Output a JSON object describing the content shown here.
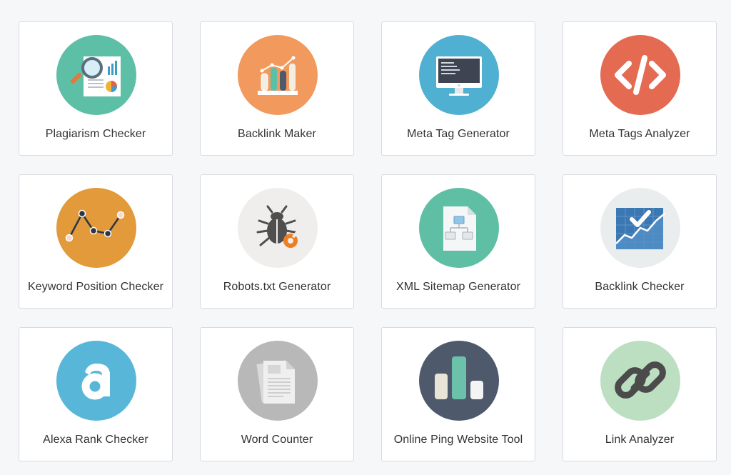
{
  "tools": [
    {
      "label": "Plagiarism Checker",
      "icon": "magnifier-report-icon",
      "color": "#5dbfa6"
    },
    {
      "label": "Backlink Maker",
      "icon": "bar-chart-icon",
      "color": "#f29a5e"
    },
    {
      "label": "Meta Tag Generator",
      "icon": "monitor-code-icon",
      "color": "#4fb0d2"
    },
    {
      "label": "Meta Tags Analyzer",
      "icon": "code-brackets-icon",
      "color": "#e56a52"
    },
    {
      "label": "Keyword Position Checker",
      "icon": "line-graph-icon",
      "color": "#e29a3a"
    },
    {
      "label": "Robots.txt Generator",
      "icon": "bug-icon",
      "color": "#f0eeec"
    },
    {
      "label": "XML Sitemap Generator",
      "icon": "sitemap-document-icon",
      "color": "#5fbfa4"
    },
    {
      "label": "Backlink Checker",
      "icon": "chart-checkmark-icon",
      "color": "#eaedee"
    },
    {
      "label": "Alexa Rank Checker",
      "icon": "alexa-a-icon",
      "color": "#58b7d9"
    },
    {
      "label": "Word Counter",
      "icon": "document-icon",
      "color": "#b8b8b8"
    },
    {
      "label": "Online Ping Website Tool",
      "icon": "ping-bars-icon",
      "color": "#4e5a6c"
    },
    {
      "label": "Link Analyzer",
      "icon": "chain-link-icon",
      "color": "#bddfc1"
    }
  ]
}
